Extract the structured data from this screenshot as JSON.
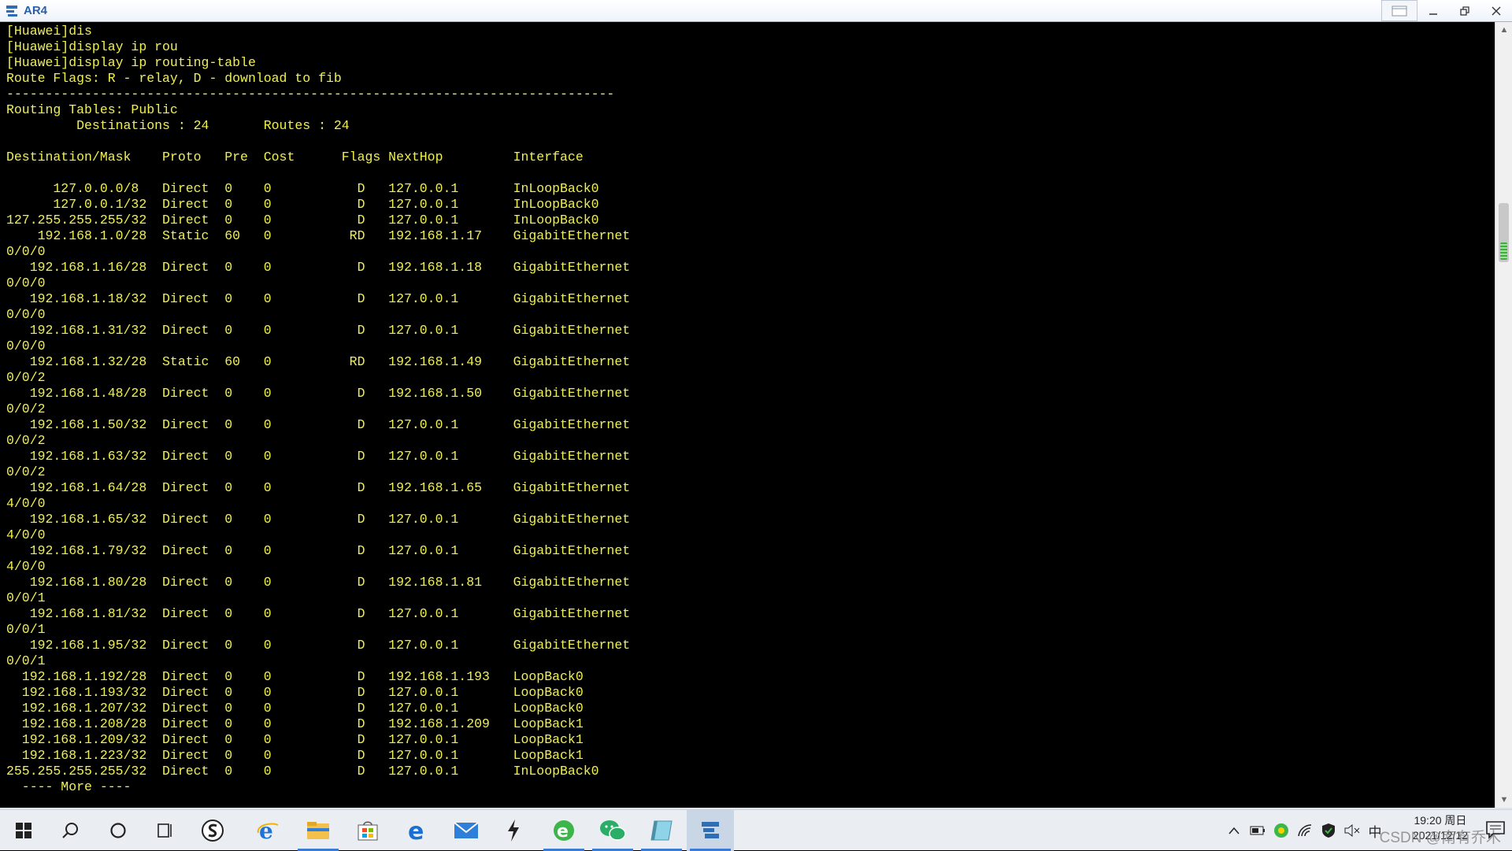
{
  "window": {
    "title": "AR4",
    "buttons": [
      "minimize",
      "restore",
      "close"
    ]
  },
  "terminal": {
    "lines": [
      "[Huawei]dis",
      "[Huawei]display ip rou",
      "[Huawei]display ip routing-table",
      "Route Flags: R - relay, D - download to fib",
      "------------------------------------------------------------------------------",
      "Routing Tables: Public",
      "         Destinations : 24       Routes : 24",
      "",
      "Destination/Mask    Proto   Pre  Cost      Flags NextHop         Interface",
      "",
      "      127.0.0.0/8   Direct  0    0           D   127.0.0.1       InLoopBack0",
      "      127.0.0.1/32  Direct  0    0           D   127.0.0.1       InLoopBack0",
      "127.255.255.255/32  Direct  0    0           D   127.0.0.1       InLoopBack0",
      "    192.168.1.0/28  Static  60   0          RD   192.168.1.17    GigabitEthernet",
      "0/0/0",
      "   192.168.1.16/28  Direct  0    0           D   192.168.1.18    GigabitEthernet",
      "0/0/0",
      "   192.168.1.18/32  Direct  0    0           D   127.0.0.1       GigabitEthernet",
      "0/0/0",
      "   192.168.1.31/32  Direct  0    0           D   127.0.0.1       GigabitEthernet",
      "0/0/0",
      "   192.168.1.32/28  Static  60   0          RD   192.168.1.49    GigabitEthernet",
      "0/0/2",
      "   192.168.1.48/28  Direct  0    0           D   192.168.1.50    GigabitEthernet",
      "0/0/2",
      "   192.168.1.50/32  Direct  0    0           D   127.0.0.1       GigabitEthernet",
      "0/0/2",
      "   192.168.1.63/32  Direct  0    0           D   127.0.0.1       GigabitEthernet",
      "0/0/2",
      "   192.168.1.64/28  Direct  0    0           D   192.168.1.65    GigabitEthernet",
      "4/0/0",
      "   192.168.1.65/32  Direct  0    0           D   127.0.0.1       GigabitEthernet",
      "4/0/0",
      "   192.168.1.79/32  Direct  0    0           D   127.0.0.1       GigabitEthernet",
      "4/0/0",
      "   192.168.1.80/28  Direct  0    0           D   192.168.1.81    GigabitEthernet",
      "0/0/1",
      "   192.168.1.81/32  Direct  0    0           D   127.0.0.1       GigabitEthernet",
      "0/0/1",
      "   192.168.1.95/32  Direct  0    0           D   127.0.0.1       GigabitEthernet",
      "0/0/1",
      "  192.168.1.192/28  Direct  0    0           D   192.168.1.193   LoopBack0",
      "  192.168.1.193/32  Direct  0    0           D   127.0.0.1       LoopBack0",
      "  192.168.1.207/32  Direct  0    0           D   127.0.0.1       LoopBack0",
      "  192.168.1.208/28  Direct  0    0           D   192.168.1.209   LoopBack1",
      "  192.168.1.209/32  Direct  0    0           D   127.0.0.1       LoopBack1",
      "  192.168.1.223/32  Direct  0    0           D   127.0.0.1       LoopBack1",
      "255.255.255.255/32  Direct  0    0           D   127.0.0.1       InLoopBack0",
      "  ---- More ----"
    ]
  },
  "taskbar": {
    "apps": [
      "start-icon",
      "search-icon",
      "cortana-icon",
      "task-view-icon",
      "app-s-icon",
      "ie-icon",
      "file-explorer-icon",
      "store-icon",
      "edge-icon",
      "mail-icon",
      "app-bolt-icon",
      "browser-360-icon",
      "wechat-icon",
      "app-book-icon",
      "ensp-icon"
    ],
    "ime": "中",
    "clock_time": "19:20 周日",
    "clock_date": "2021/12/12",
    "watermark": "CSDN @南有乔木"
  },
  "colors": {
    "terminal_bg": "#000000",
    "terminal_text": "#f0f050",
    "taskbar_bg": "#eaeef3",
    "accent": "#3a7bd5"
  }
}
